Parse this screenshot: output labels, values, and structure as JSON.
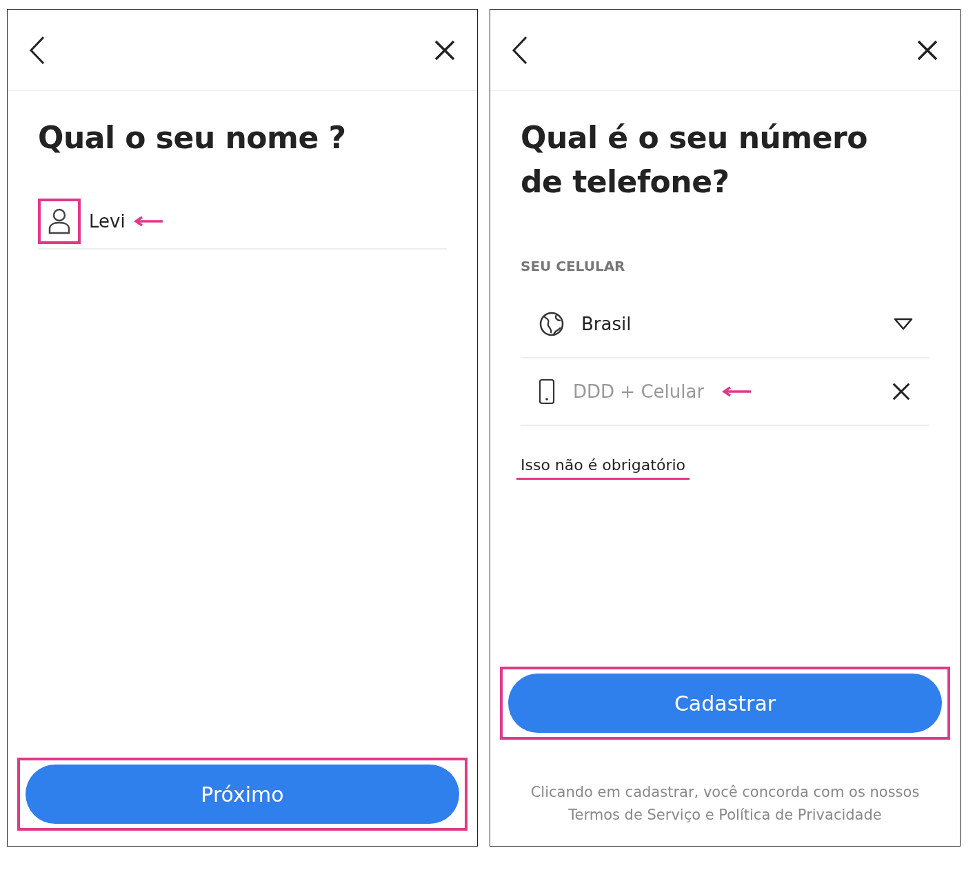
{
  "name_screen": {
    "title": "Qual o seu nome ?",
    "field": {
      "value": "Levi",
      "icon_highlighted": true,
      "pointer": true
    },
    "button": {
      "label": "Próximo",
      "highlighted": true
    }
  },
  "phone_screen": {
    "title": "Qual é o seu número de telefone?",
    "section_label": "SEU CELULAR",
    "country": {
      "value": "Brasil"
    },
    "phone": {
      "placeholder": "DDD + Celular",
      "pointer": true
    },
    "optional_link": {
      "label": "Isso não é obrigatório",
      "underlined": true
    },
    "button": {
      "label": "Cadastrar",
      "highlighted": true
    },
    "terms": "Clicando em cadastrar, você concorda com os nossos Termos de Serviço e Política de Privacidade"
  }
}
